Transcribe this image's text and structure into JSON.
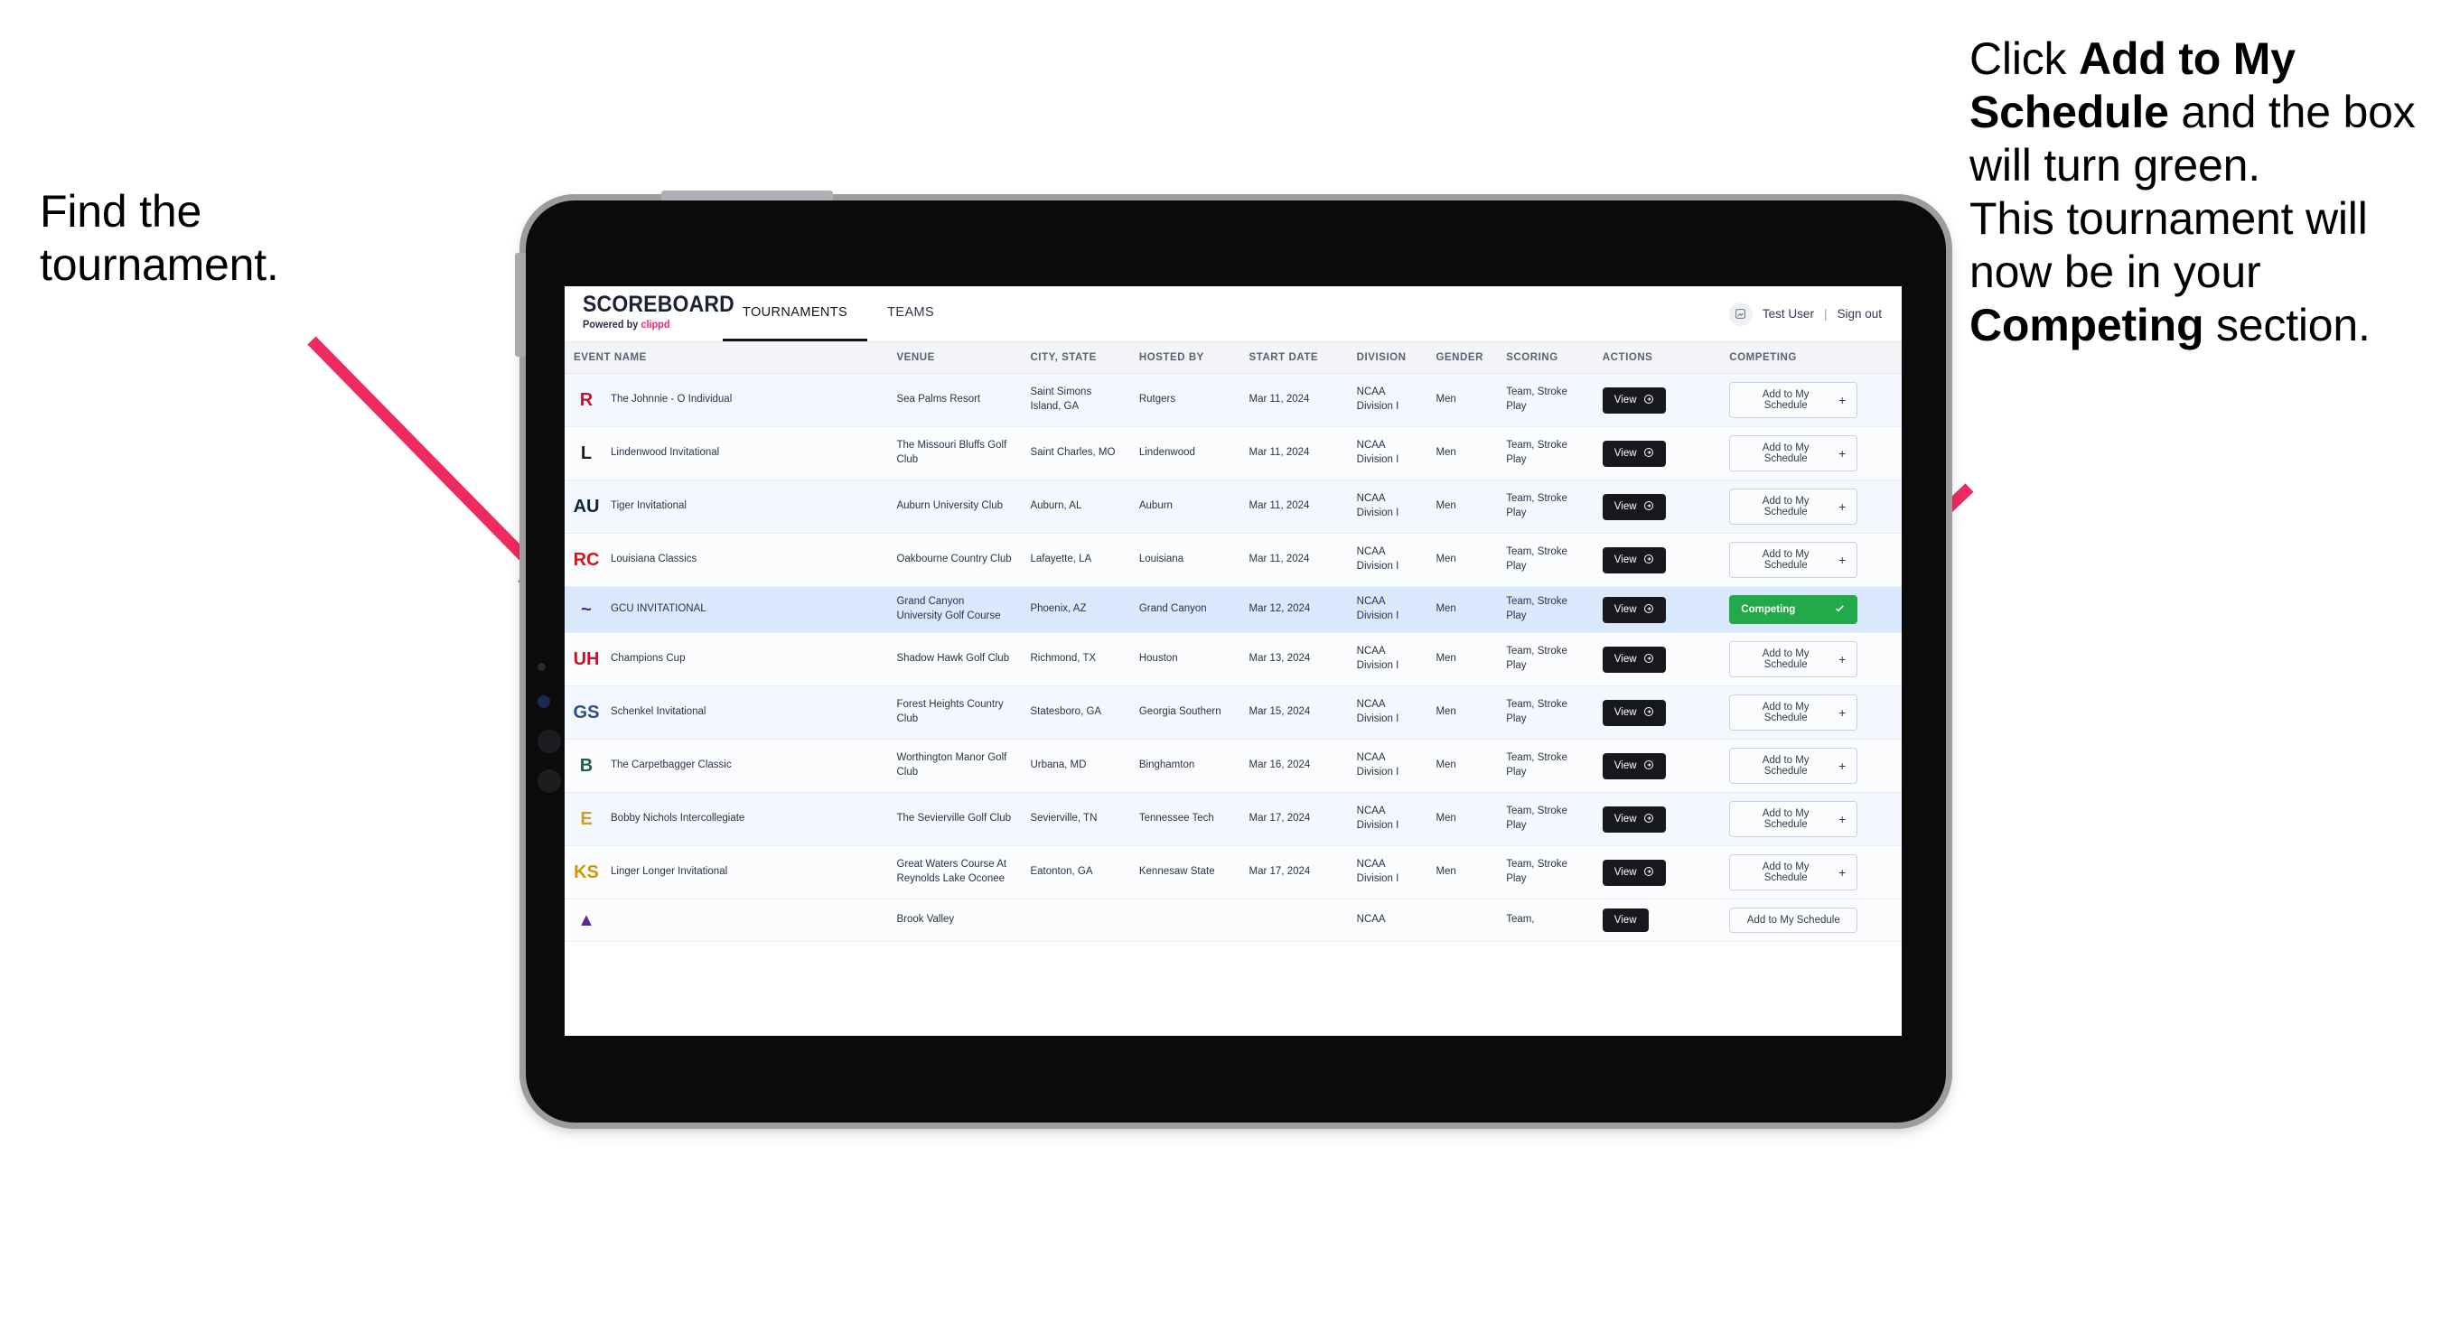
{
  "annotations": {
    "left": {
      "line1": "Find the",
      "line2": "tournament."
    },
    "right": {
      "p1_a": "Click ",
      "p1_b": "Add to My Schedule",
      "p1_c": " and the box will turn green.",
      "p2_a": "This tournament will now be in your ",
      "p2_b": "Competing",
      "p2_c": " section."
    }
  },
  "app": {
    "brand": {
      "title": "SCOREBOARD",
      "powered_by": "Powered by ",
      "vendor": "clippd"
    },
    "nav": [
      {
        "label": "TOURNAMENTS",
        "active": true
      },
      {
        "label": "TEAMS",
        "active": false
      }
    ],
    "user": {
      "name": "Test User",
      "separator": "|",
      "sign_out": "Sign out",
      "avatar_icon": "user-avatar-icon"
    },
    "colors": {
      "accent_pink": "#f4266c",
      "competing_green": "#22a94a",
      "arrow_pink": "#ee2a5f",
      "selected_row": "#d9e8fb",
      "view_button": "#16181d"
    }
  },
  "table": {
    "columns": [
      "EVENT NAME",
      "VENUE",
      "CITY, STATE",
      "HOSTED BY",
      "START DATE",
      "DIVISION",
      "GENDER",
      "SCORING",
      "ACTIONS",
      "COMPETING"
    ],
    "buttons": {
      "view": "View",
      "add": "Add to My Schedule",
      "add_plus": "+",
      "competing": "Competing"
    },
    "rows": [
      {
        "event": "The Johnnie - O Individual",
        "logo_text": "R",
        "logo_color": "#c8102e",
        "logo_bg": "transparent",
        "venue": "Sea Palms Resort",
        "city": "Saint Simons Island, GA",
        "host": "Rutgers",
        "date": "Mar 11, 2024",
        "division": "NCAA Division I",
        "gender": "Men",
        "scoring": "Team, Stroke Play",
        "competing": false
      },
      {
        "event": "Lindenwood Invitational",
        "logo_text": "L",
        "logo_color": "#1b1b1b",
        "logo_bg": "transparent",
        "venue": "The Missouri Bluffs Golf Club",
        "city": "Saint Charles, MO",
        "host": "Lindenwood",
        "date": "Mar 11, 2024",
        "division": "NCAA Division I",
        "gender": "Men",
        "scoring": "Team, Stroke Play",
        "competing": false
      },
      {
        "event": "Tiger Invitational",
        "logo_text": "AU",
        "logo_color": "#0c2340",
        "logo_bg": "transparent",
        "venue": "Auburn University Club",
        "city": "Auburn, AL",
        "host": "Auburn",
        "date": "Mar 11, 2024",
        "division": "NCAA Division I",
        "gender": "Men",
        "scoring": "Team, Stroke Play",
        "competing": false
      },
      {
        "event": "Louisiana Classics",
        "logo_text": "RC",
        "logo_color": "#ce181e",
        "logo_bg": "transparent",
        "venue": "Oakbourne Country Club",
        "city": "Lafayette, LA",
        "host": "Louisiana",
        "date": "Mar 11, 2024",
        "division": "NCAA Division I",
        "gender": "Men",
        "scoring": "Team, Stroke Play",
        "competing": false
      },
      {
        "event": "GCU INVITATIONAL",
        "logo_text": "~",
        "logo_color": "#522398",
        "logo_bg": "transparent",
        "venue": "Grand Canyon University Golf Course",
        "city": "Phoenix, AZ",
        "host": "Grand Canyon",
        "date": "Mar 12, 2024",
        "division": "NCAA Division I",
        "gender": "Men",
        "scoring": "Team, Stroke Play",
        "competing": true
      },
      {
        "event": "Champions Cup",
        "logo_text": "UH",
        "logo_color": "#c8102e",
        "logo_bg": "transparent",
        "venue": "Shadow Hawk Golf Club",
        "city": "Richmond, TX",
        "host": "Houston",
        "date": "Mar 13, 2024",
        "division": "NCAA Division I",
        "gender": "Men",
        "scoring": "Team, Stroke Play",
        "competing": false
      },
      {
        "event": "Schenkel Invitational",
        "logo_text": "GS",
        "logo_color": "#2b4f81",
        "logo_bg": "transparent",
        "venue": "Forest Heights Country Club",
        "city": "Statesboro, GA",
        "host": "Georgia Southern",
        "date": "Mar 15, 2024",
        "division": "NCAA Division I",
        "gender": "Men",
        "scoring": "Team, Stroke Play",
        "competing": false
      },
      {
        "event": "The Carpetbagger Classic",
        "logo_text": "B",
        "logo_color": "#1c6149",
        "logo_bg": "transparent",
        "venue": "Worthington Manor Golf Club",
        "city": "Urbana, MD",
        "host": "Binghamton",
        "date": "Mar 16, 2024",
        "division": "NCAA Division I",
        "gender": "Men",
        "scoring": "Team, Stroke Play",
        "competing": false
      },
      {
        "event": "Bobby Nichols Intercollegiate",
        "logo_text": "E",
        "logo_color": "#c9a227",
        "logo_bg": "transparent",
        "venue": "The Sevierville Golf Club",
        "city": "Sevierville, TN",
        "host": "Tennessee Tech",
        "date": "Mar 17, 2024",
        "division": "NCAA Division I",
        "gender": "Men",
        "scoring": "Team, Stroke Play",
        "competing": false
      },
      {
        "event": "Linger Longer Invitational",
        "logo_text": "KS",
        "logo_color": "#cc9900",
        "logo_bg": "transparent",
        "venue": "Great Waters Course At Reynolds Lake Oconee",
        "city": "Eatonton, GA",
        "host": "Kennesaw State",
        "date": "Mar 17, 2024",
        "division": "NCAA Division I",
        "gender": "Men",
        "scoring": "Team, Stroke Play",
        "competing": false
      }
    ],
    "partial_row": {
      "venue": "Brook Valley",
      "division": "NCAA",
      "scoring": "Team,"
    }
  }
}
